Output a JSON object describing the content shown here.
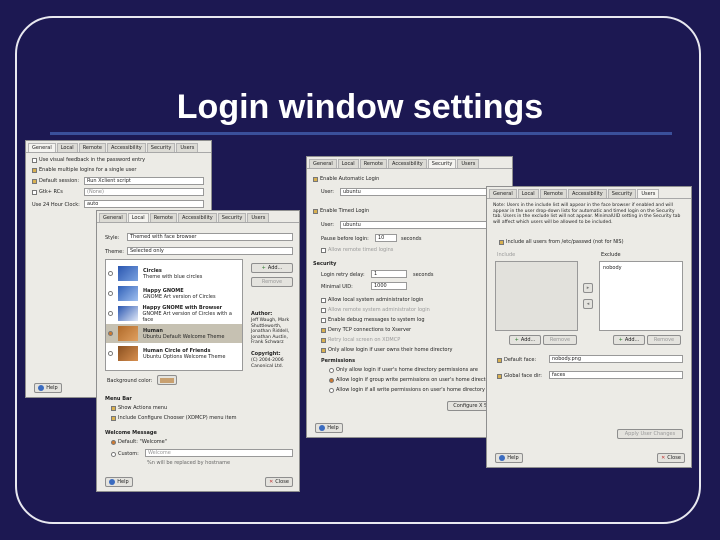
{
  "slide": {
    "title": "Login window settings"
  },
  "win_general": {
    "tabs": [
      "General",
      "Local",
      "Remote",
      "Accessibility",
      "Security",
      "Users"
    ],
    "options": [
      {
        "label": "Use visual feedback in the password entry",
        "checked": false
      },
      {
        "label": "Enable multiple logins for a single user",
        "checked": true
      },
      {
        "label": "Default session:",
        "checked": true
      },
      {
        "label": "Gtk+ RCs",
        "checked": false
      }
    ],
    "session_value": "Run Xclient script",
    "rc_value": "(None)",
    "clock_label": "Use 24 Hour Clock:",
    "clock_value": "auto",
    "help_label": "Help"
  },
  "win_local": {
    "tabs": [
      "General",
      "Local",
      "Remote",
      "Accessibility",
      "Security",
      "Users"
    ],
    "style_label": "Style:",
    "style_value": "Themed with face browser",
    "theme_label": "Theme:",
    "theme_value": "Selected only",
    "themes": [
      {
        "name": "Circles",
        "desc": "Theme with blue circles",
        "selected": false,
        "radio": false
      },
      {
        "name": "Happy GNOME",
        "desc": "GNOME Art version of Circles",
        "selected": false,
        "radio": false
      },
      {
        "name": "Happy GNOME with Browser",
        "desc": "GNOME Art version of Circles with a face",
        "selected": false,
        "radio": false
      },
      {
        "name": "Human",
        "desc": "Ubuntu Default Welcome Theme",
        "selected": true,
        "radio": true
      },
      {
        "name": "Human Circle of Friends",
        "desc": "Ubuntu Options Welcome Theme",
        "selected": false,
        "radio": false
      }
    ],
    "add_label": "Add...",
    "remove_label": "Remove",
    "author_label": "Author:",
    "author_value": "Jeff Waugh, Mark Shuttleworth, Jonathan Riddell, Jonathan Austin, Frank Schwarz",
    "copyright_label": "Copyright:",
    "copyright_value": "(C) 2004-2006 Canonical Ltd.",
    "bgcolor_label": "Background color:",
    "menubar_title": "Menu Bar",
    "menubar_options": [
      {
        "label": "Show Actions menu",
        "checked": true
      },
      {
        "label": "Include Configure Chooser (XDMCP) menu item",
        "checked": true
      }
    ],
    "welcome_title": "Welcome Message",
    "welcome_options": [
      {
        "label": "Default: \"Welcome\"",
        "checked": true
      },
      {
        "label": "Custom:",
        "checked": false
      }
    ],
    "custom_value": "Welcome",
    "hint": "%n will be replaced by hostname",
    "help_label": "Help",
    "close_label": "Close"
  },
  "win_security": {
    "tabs": [
      "General",
      "Local",
      "Remote",
      "Accessibility",
      "Security",
      "Users"
    ],
    "auto_login_label": "Enable Automatic Login",
    "user_label": "User:",
    "auto_user_value": "ubuntu",
    "timed_login_label": "Enable Timed Login",
    "timed_user_value": "ubuntu",
    "pause_label": "Pause before login:",
    "pause_value": "10",
    "seconds_label": "seconds",
    "allow_remote_timed": "Allow remote timed logins",
    "security_title": "Security",
    "retry_label": "Login retry delay:",
    "retry_value": "1",
    "retry_unit": "seconds",
    "minimal_uid_label": "Minimal UID:",
    "minimal_uid_value": "1000",
    "options": [
      {
        "label": "Allow local system administrator login",
        "checked": false
      },
      {
        "label": "Allow remote system administrator login",
        "checked": false
      },
      {
        "label": "Enable debug messages to system log",
        "checked": false
      },
      {
        "label": "Deny TCP connections to Xserver",
        "checked": true
      },
      {
        "label": "Retry local screen on XDMCP",
        "checked": true
      },
      {
        "label": "Only allow login if user owns their home directory",
        "checked": true
      }
    ],
    "permissions_title": "Permissions",
    "permissions": [
      {
        "label": "Only allow login if user's home directory permissions are",
        "checked": false
      },
      {
        "label": "Allow login if group write permissions on user's home directory",
        "checked": true
      },
      {
        "label": "Allow login if all write permissions on user's home directory",
        "checked": false
      }
    ],
    "configure_label": "Configure X Server...",
    "help_label": "Help"
  },
  "win_users": {
    "tabs": [
      "General",
      "Local",
      "Remote",
      "Accessibility",
      "Security",
      "Users"
    ],
    "note": "Note: Users in the include list will appear in the face browser if enabled and will appear in the user drop-down lists for automatic and timed login on the Security tab. Users in the exclude list will not appear. MinimalUID setting in the Security tab will affect which users will be allowed to be included.",
    "include_all_label": "Include all users from /etc/passwd (not for NIS)",
    "include_label": "Include",
    "exclude_label": "Exclude",
    "exclude_items": [
      "nobody"
    ],
    "add_label": "Add...",
    "remove_label": "Remove",
    "default_face_label": "Default face:",
    "default_face_value": "nobody.png",
    "global_face_label": "Global face dir:",
    "global_face_value": "faces",
    "apply_label": "Apply User Changes",
    "help_label": "Help",
    "close_label": "Close"
  }
}
